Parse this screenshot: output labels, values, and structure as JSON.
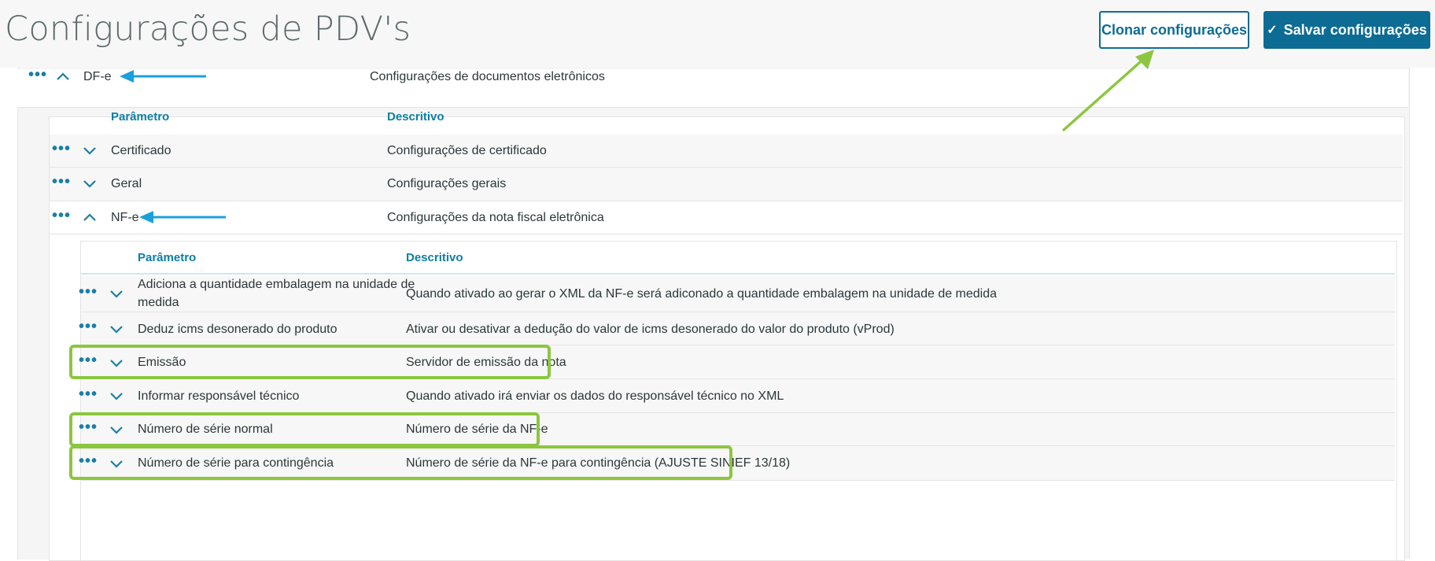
{
  "page": {
    "title": "Configurações de PDV's",
    "clone_button": "Clonar configurações",
    "save_button": "Salvar configurações"
  },
  "level1": {
    "label": "DF-e",
    "description": "Configurações de documentos eletrônicos"
  },
  "level2": {
    "header_param": "Parâmetro",
    "header_desc": "Descritivo",
    "rows": [
      {
        "label": "Certificado",
        "description": "Configurações de certificado"
      },
      {
        "label": "Geral",
        "description": "Configurações gerais"
      },
      {
        "label": "NF-e",
        "description": "Configurações da nota fiscal eletrônica"
      }
    ]
  },
  "level3": {
    "header_param": "Parâmetro",
    "header_desc": "Descritivo",
    "rows": [
      {
        "label_line1": "Adiciona a quantidade embalagem na unidade de",
        "label_line2": "medida",
        "description": "Quando ativado ao gerar o XML da NF-e será adiconado a quantidade embalagem na unidade de medida"
      },
      {
        "label": "Deduz icms desonerado do produto",
        "description": "Ativar ou desativar a dedução do valor de icms desonerado do valor do produto (vProd)"
      },
      {
        "label": "Emissão",
        "description": "Servidor de emissão da nota"
      },
      {
        "label": "Informar responsável técnico",
        "description": "Quando ativado irá enviar os dados do responsável técnico no XML"
      },
      {
        "label": "Número de série normal",
        "description": "Número de série da NF-e"
      },
      {
        "label": "Número de série para contingência",
        "description": "Número de série da NF-e para contingência (AJUSTE SINIEF 13/18)"
      }
    ]
  },
  "icons": {
    "more": "more-dots-icon",
    "expand": "chevron-down-icon",
    "collapse": "chevron-up-icon"
  },
  "colors": {
    "primary": "#0c6c94",
    "header_text": "#0c7fa3",
    "highlight": "#8cc63f",
    "arrow_blue": "#1aa0dc"
  }
}
